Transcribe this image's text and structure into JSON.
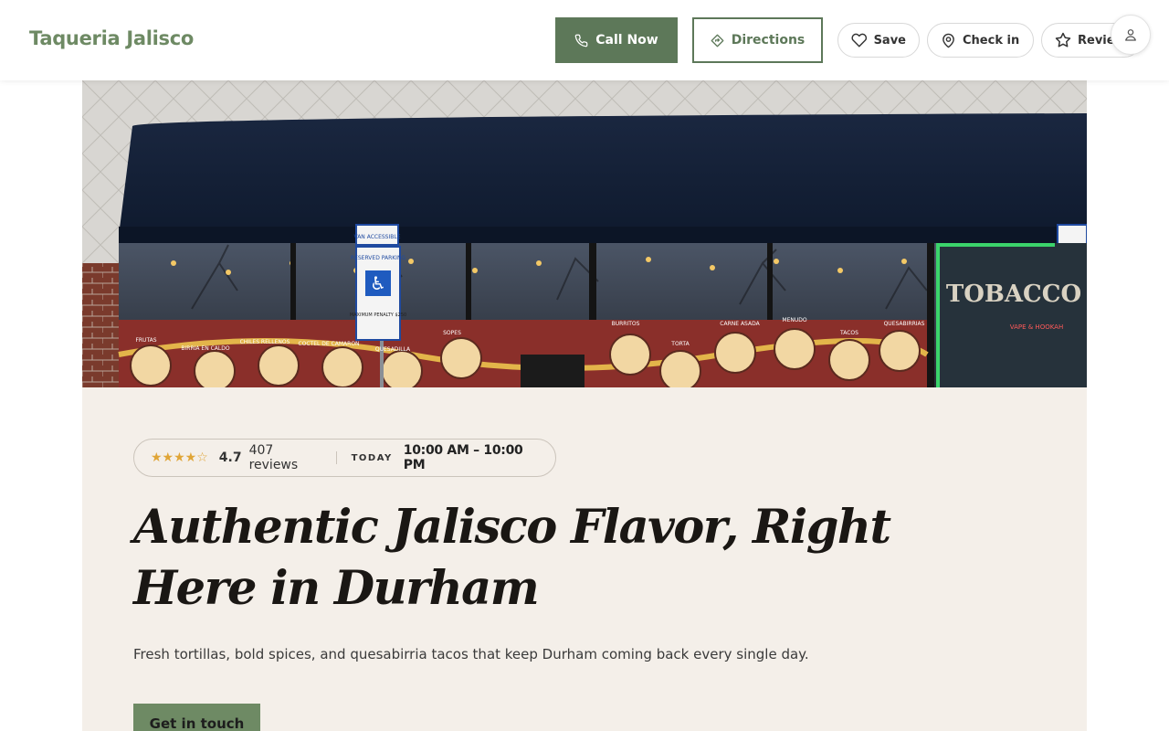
{
  "header": {
    "brand": "Taqueria Jalisco",
    "call_label": "Call Now",
    "directions_label": "Directions",
    "save_label": "Save",
    "checkin_label": "Check in",
    "review_label": "Review"
  },
  "hero": {
    "photo_alt": "Storefront of Taqueria Jalisco",
    "signs": {
      "van_accessible": "VAN ACCESSIBLE",
      "reserved_parking": "RESERVED PARKING",
      "maximum_penalty": "MAXIMUM PENALTY $250",
      "tobacco": "TOBACCO",
      "vape": "VAPE & HOOKAH"
    },
    "menu_items": [
      "FRUTAS",
      "BIRRIA EN CALDO",
      "CHILES RELLENOS",
      "COCTEL DE CAMARON",
      "QUESADILLA",
      "SOPES",
      "BURRITOS",
      "TORTA",
      "CARNE ASADA",
      "MENUDO",
      "TACOS",
      "QUESABIRRIAS"
    ]
  },
  "info": {
    "stars": "★★★★☆",
    "rating": "4.7",
    "reviews": "407 reviews",
    "today_label": "TODAY",
    "hours": "10:00 AM – 10:00 PM"
  },
  "headline": "Authentic Jalisco Flavor, Right Here in Durham",
  "subtitle": "Fresh tortillas, bold spices, and quesabirria tacos that keep Durham coming back every single day.",
  "cta_label": "Get in touch",
  "colors": {
    "brand_green": "#6e8a64",
    "button_green": "#5d7859",
    "card_background": "#f4efe9",
    "star_gold": "#e0a537"
  },
  "icons": {
    "call": "phone-icon",
    "directions": "directions-icon",
    "save": "heart-icon",
    "checkin": "map-pin-icon",
    "review": "star-icon",
    "account": "user-icon"
  }
}
